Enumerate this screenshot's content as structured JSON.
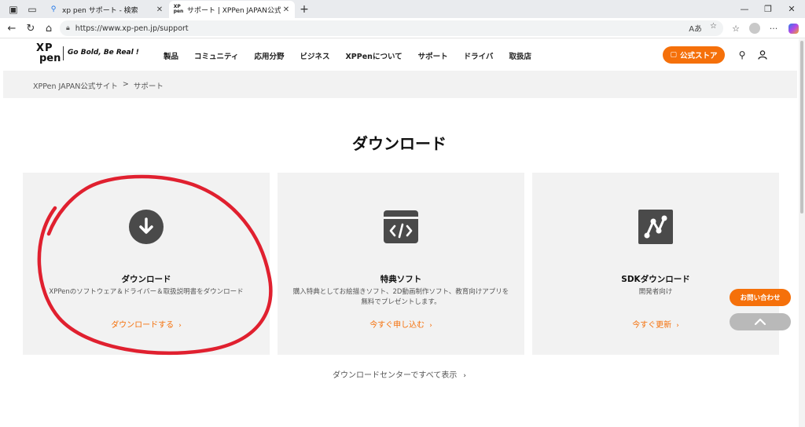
{
  "browser": {
    "tabs": [
      {
        "title": "xp pen サポート - 検索",
        "favicon": "search-icon",
        "active": false
      },
      {
        "title": "サポート | XPPen JAPAN公式サイト",
        "favicon": "xppen-favicon",
        "active": true
      }
    ],
    "new_tab_label": "+",
    "url": "https://www.xp-pen.jp/support"
  },
  "site": {
    "logo_line1": "XP",
    "logo_line2": "pen",
    "tagline": "Go Bold, Be Real !",
    "nav": [
      "製品",
      "コミュニティ",
      "応用分野",
      "ビジネス",
      "XPPenについて",
      "サポート",
      "ドライバ",
      "取扱店"
    ],
    "store_label": "公式ストア",
    "accent_color": "#f5700a"
  },
  "breadcrumb": {
    "home": "XPPen JAPAN公式サイト",
    "separator": ">",
    "current": "サポート"
  },
  "page": {
    "title": "ダウンロード",
    "cards": [
      {
        "icon": "download-icon",
        "title": "ダウンロード",
        "description": "XPPenのソフトウェア＆ドライバー＆取扱説明書をダウンロード",
        "link": "ダウンロードする"
      },
      {
        "icon": "code-window-icon",
        "title": "特典ソフト",
        "description": "購入特典としてお絵描きソフト、2D動画制作ソフト、教育向けアプリを無料でプレゼントします。",
        "link": "今すぐ申し込む"
      },
      {
        "icon": "sdk-graph-icon",
        "title": "SDKダウンロード",
        "description": "開発者向け",
        "link": "今すぐ更新"
      }
    ],
    "all_downloads": "ダウンロードセンターですべて表示",
    "chevron": "›"
  },
  "floating": {
    "contact": "お問い合わせ"
  },
  "annotation_color": "#e0202f"
}
